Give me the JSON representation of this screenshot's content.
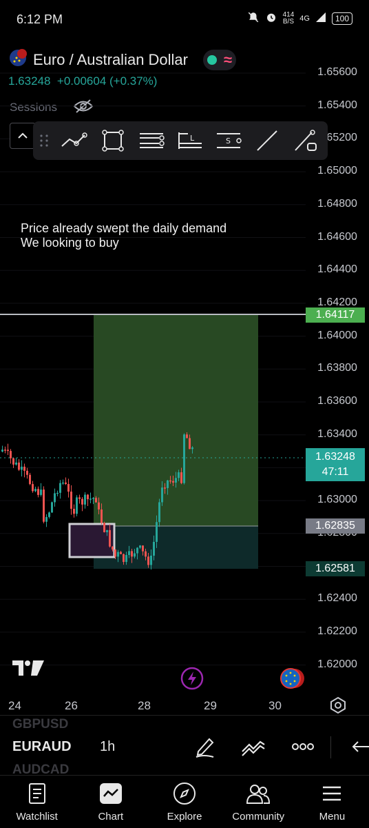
{
  "status_bar": {
    "time": "6:12 PM",
    "speed_value": "414",
    "speed_unit": "B/S",
    "network": "4G",
    "battery": "100"
  },
  "symbol": {
    "title": "Euro / Australian Dollar",
    "price": "1.63248",
    "change": "+0.00604 (+0.37%)",
    "sessions_label": "Sessions"
  },
  "toolbar": {
    "tools": [
      "trend-line",
      "rectangle",
      "parallel-channel",
      "long-position",
      "short-position",
      "ray",
      "path"
    ]
  },
  "annotation": {
    "line1": "Price already swept the daily demand",
    "line2": "We looking to buy"
  },
  "price_axis": {
    "labels": [
      "1.65600",
      "1.65400",
      "1.65200",
      "1.65000",
      "1.64800",
      "1.64600",
      "1.64400",
      "1.64200",
      "1.64000",
      "1.63800",
      "1.63600",
      "1.63400",
      "1.63200",
      "1.63000",
      "1.62800",
      "1.62600",
      "1.62400",
      "1.62200",
      "1.62000"
    ],
    "tags": {
      "target": {
        "value": "1.64117",
        "color": "#4caf50"
      },
      "current": {
        "value": "1.63248",
        "countdown": "47:11",
        "color": "#26a69a"
      },
      "entry": {
        "value": "1.62835",
        "color": "#787b86"
      },
      "stop": {
        "value": "1.62581",
        "color": "#0d3b33"
      }
    }
  },
  "time_axis": {
    "labels": [
      "24",
      "26",
      "28",
      "29",
      "30"
    ]
  },
  "pair_bar": {
    "prev_symbol": "GBPUSD",
    "symbol": "EURAUD",
    "next_symbol": "AUDCAD",
    "interval": "1h"
  },
  "nav": {
    "items": [
      "Watchlist",
      "Chart",
      "Explore",
      "Community",
      "Menu"
    ]
  },
  "colors": {
    "up": "#26a69a",
    "down": "#ef5350",
    "profit_zone": "#2a4d25",
    "loss_zone": "#0e2a2a",
    "accent": "#26a69a"
  }
}
